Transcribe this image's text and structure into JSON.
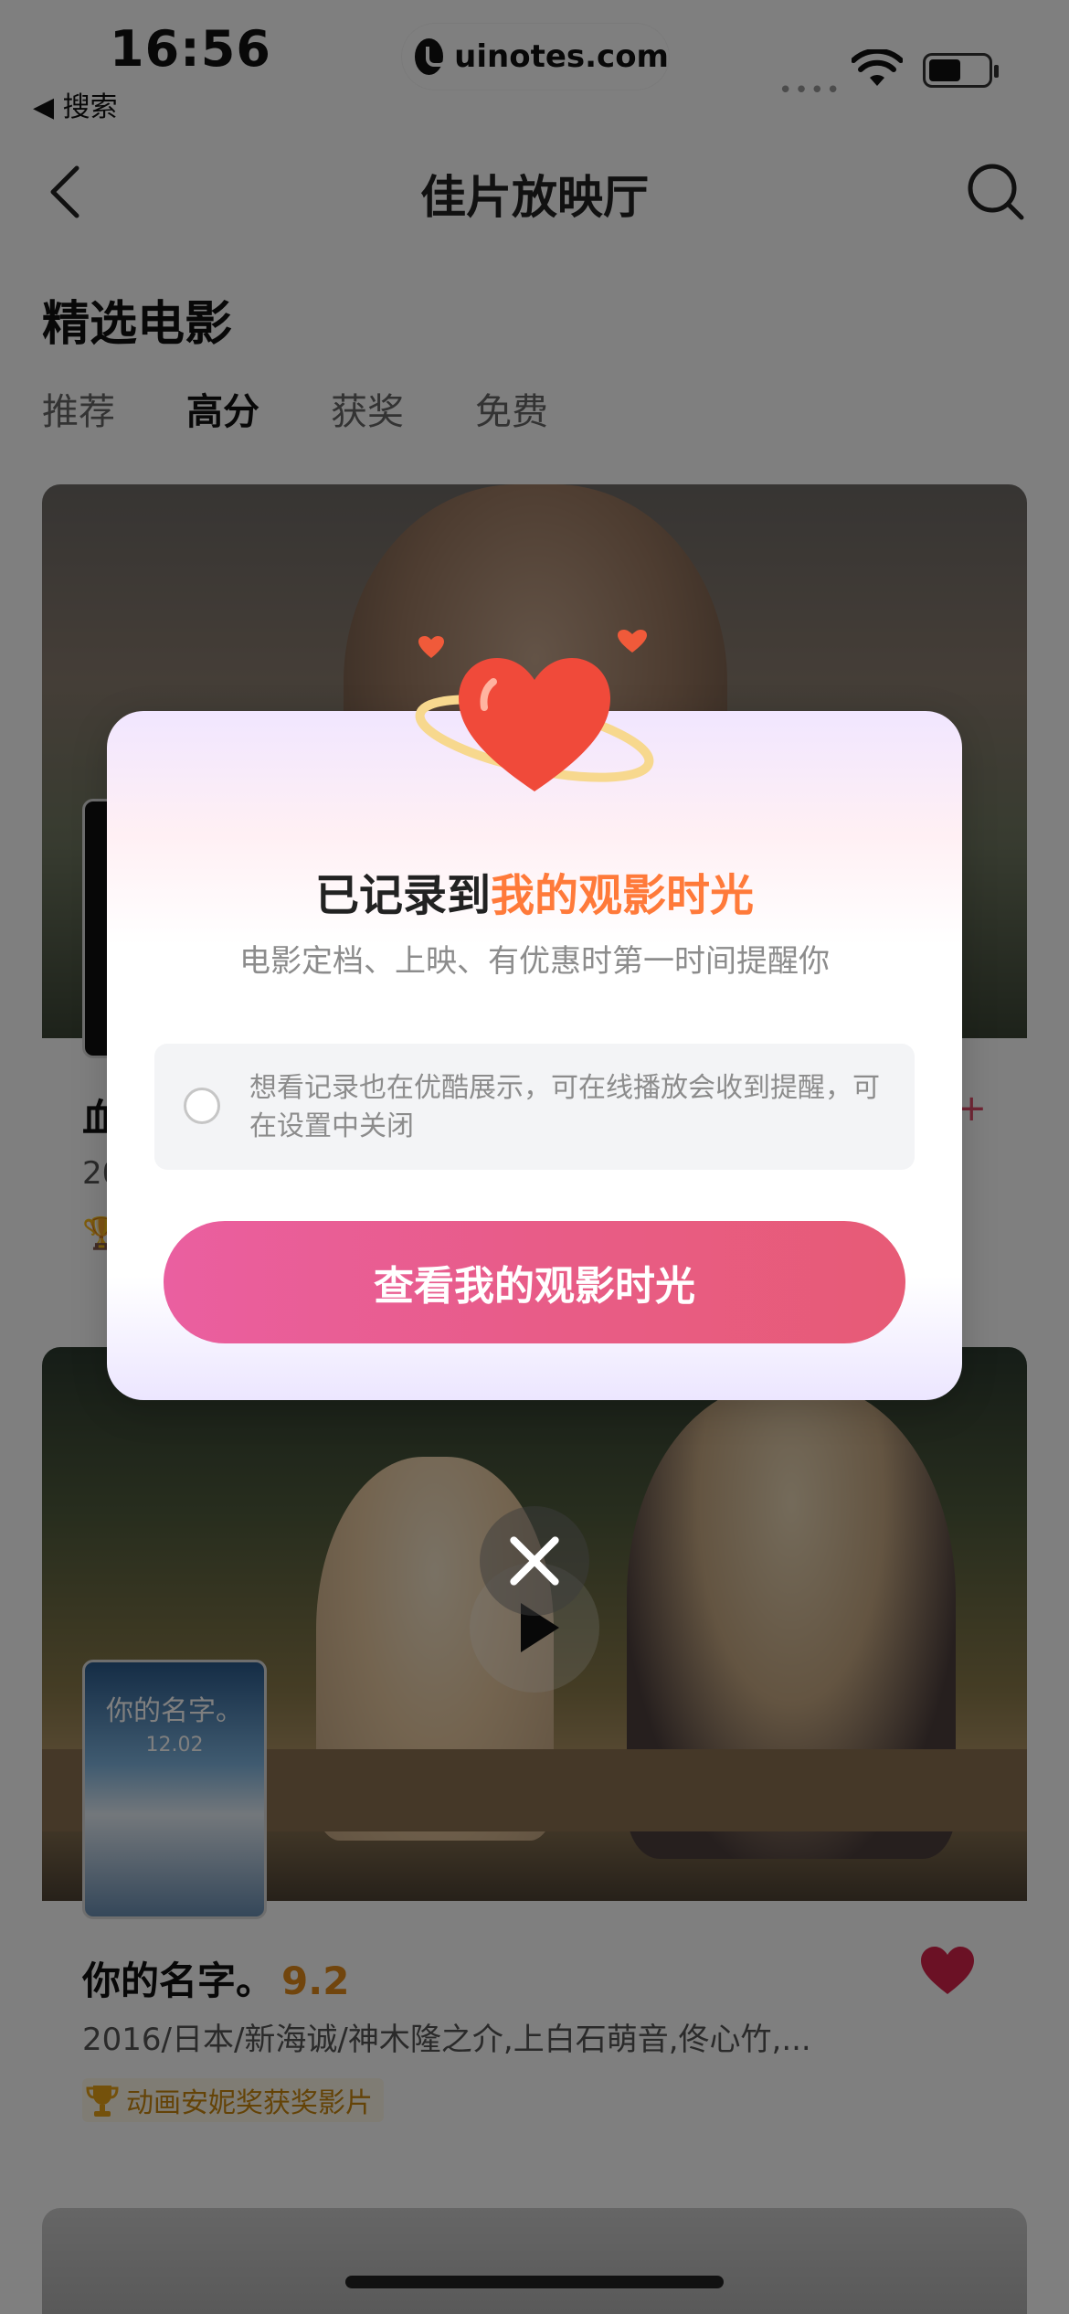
{
  "status_bar": {
    "time": "16:56",
    "back_app": "◀ 搜索",
    "url": "uinotes.com",
    "signal": "••••"
  },
  "nav": {
    "title": "佳片放映厅"
  },
  "section": {
    "title": "精选电影",
    "tabs": [
      {
        "label": "推荐",
        "active": false
      },
      {
        "label": "高分",
        "active": true
      },
      {
        "label": "获奖",
        "active": false
      },
      {
        "label": "免费",
        "active": false
      }
    ]
  },
  "cards": [
    {
      "title_partial": "血",
      "meta_partial": "20",
      "badge_icon": "trophy-icon"
    },
    {
      "title": "你的名字。",
      "score": "9.2",
      "meta": "2016/日本/新海诚/神木隆之介,上白石萌音,佟心竹,...",
      "award": "动画安妮奖获奖影片",
      "poster_title": "你的名字。",
      "poster_date": "12.02"
    }
  ],
  "modal": {
    "title_plain": "已记录到",
    "title_accent": "我的观影时光",
    "subtitle": "电影定档、上映、有优惠时第一时间提醒你",
    "notice": "想看记录也在优酷展示，可在线播放会收到提醒，可在设置中关闭",
    "cta": "查看我的观影时光"
  },
  "colors": {
    "accent_orange": "#ff7a3a",
    "cta_pink": "#e85c88",
    "fav_red": "#d6224a",
    "score_orange": "#e28a1a"
  }
}
